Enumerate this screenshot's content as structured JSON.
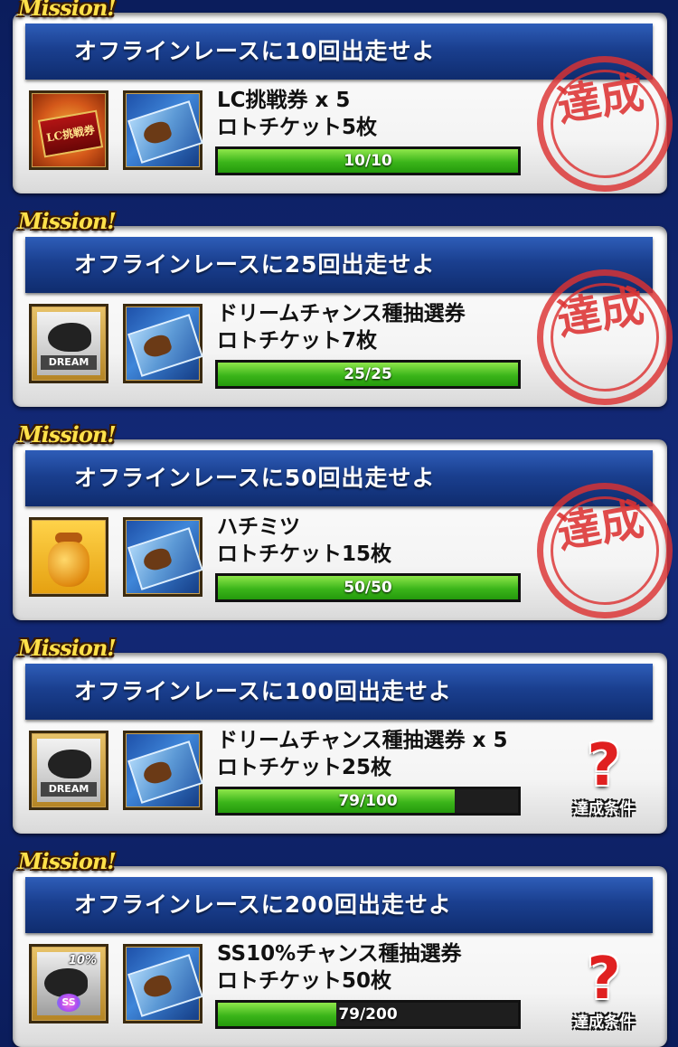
{
  "mission_tag": "Mission!",
  "missions": [
    {
      "title": "オフラインレースに10回出走せよ",
      "reward_1": "LC挑戦券 x 5",
      "reward_2": "ロトチケット5枚",
      "icon_a": "lc-ticket-icon",
      "icon_a_label": "LC挑戦券",
      "icon_b": "loto-ticket-icon",
      "progress_text": "10/10",
      "progress_value": 10,
      "progress_max": 10,
      "status": "達成"
    },
    {
      "title": "オフラインレースに25回出走せよ",
      "reward_1": "ドリームチャンス種抽選券",
      "reward_2": "ロトチケット7枚",
      "icon_a": "dream-chance-icon",
      "icon_a_label": "DREAM",
      "icon_b": "loto-ticket-icon",
      "progress_text": "25/25",
      "progress_value": 25,
      "progress_max": 25,
      "status": "達成"
    },
    {
      "title": "オフラインレースに50回出走せよ",
      "reward_1": "ハチミツ",
      "reward_2": "ロトチケット15枚",
      "icon_a": "honey-jar-icon",
      "icon_b": "loto-ticket-icon",
      "progress_text": "50/50",
      "progress_value": 50,
      "progress_max": 50,
      "status": "達成"
    },
    {
      "title": "オフラインレースに100回出走せよ",
      "reward_1": "ドリームチャンス種抽選券 x 5",
      "reward_2": "ロトチケット25枚",
      "icon_a": "dream-chance-icon",
      "icon_a_label": "DREAM",
      "icon_b": "loto-ticket-icon",
      "progress_text": "79/100",
      "progress_value": 79,
      "progress_max": 100,
      "status": "?",
      "condition_label": "達成条件"
    },
    {
      "title": "オフラインレースに200回出走せよ",
      "reward_1": "SS10%チャンス種抽選券",
      "reward_2": "ロトチケット50枚",
      "icon_a": "ss10-chance-icon",
      "icon_a_label": "10%",
      "icon_a_badge": "SS",
      "icon_b": "loto-ticket-icon",
      "progress_text": "79/200",
      "progress_value": 79,
      "progress_max": 200,
      "status": "?",
      "condition_label": "達成条件"
    }
  ],
  "colors": {
    "progress_fill": "#3bb51a",
    "title_bar": "#1a3f8f",
    "stamp": "#dc3232",
    "background": "#0b1d5c"
  }
}
